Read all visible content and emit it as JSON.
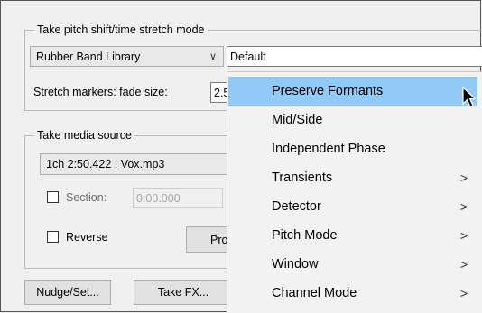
{
  "pitch_group": {
    "title": "Take pitch shift/time stretch mode",
    "algorithm_select": "Rubber Band Library",
    "preset_select": "Default",
    "stretch_label": "Stretch markers: fade size:",
    "stretch_value": "2.5"
  },
  "media_group": {
    "title": "Take media source",
    "source_select": "1ch 2:50.422 : Vox.mp3",
    "section_label": "Section:",
    "section_value": "0:00.000",
    "reverse_label": "Reverse",
    "properties_button": "Prop"
  },
  "buttons": {
    "nudge": "Nudge/Set...",
    "take_fx": "Take FX..."
  },
  "menu": {
    "items": [
      {
        "label": "Preserve Formants",
        "submenu": false,
        "highlighted": true
      },
      {
        "label": "Mid/Side",
        "submenu": false,
        "highlighted": false
      },
      {
        "label": "Independent Phase",
        "submenu": false,
        "highlighted": false
      },
      {
        "label": "Transients",
        "submenu": true,
        "highlighted": false
      },
      {
        "label": "Detector",
        "submenu": true,
        "highlighted": false
      },
      {
        "label": "Pitch Mode",
        "submenu": true,
        "highlighted": false
      },
      {
        "label": "Window",
        "submenu": true,
        "highlighted": false
      },
      {
        "label": "Channel Mode",
        "submenu": true,
        "highlighted": false
      }
    ],
    "arrow_glyph": ">"
  },
  "colors": {
    "highlight": "#91c9f7",
    "window_bg": "#f0f0f0"
  }
}
